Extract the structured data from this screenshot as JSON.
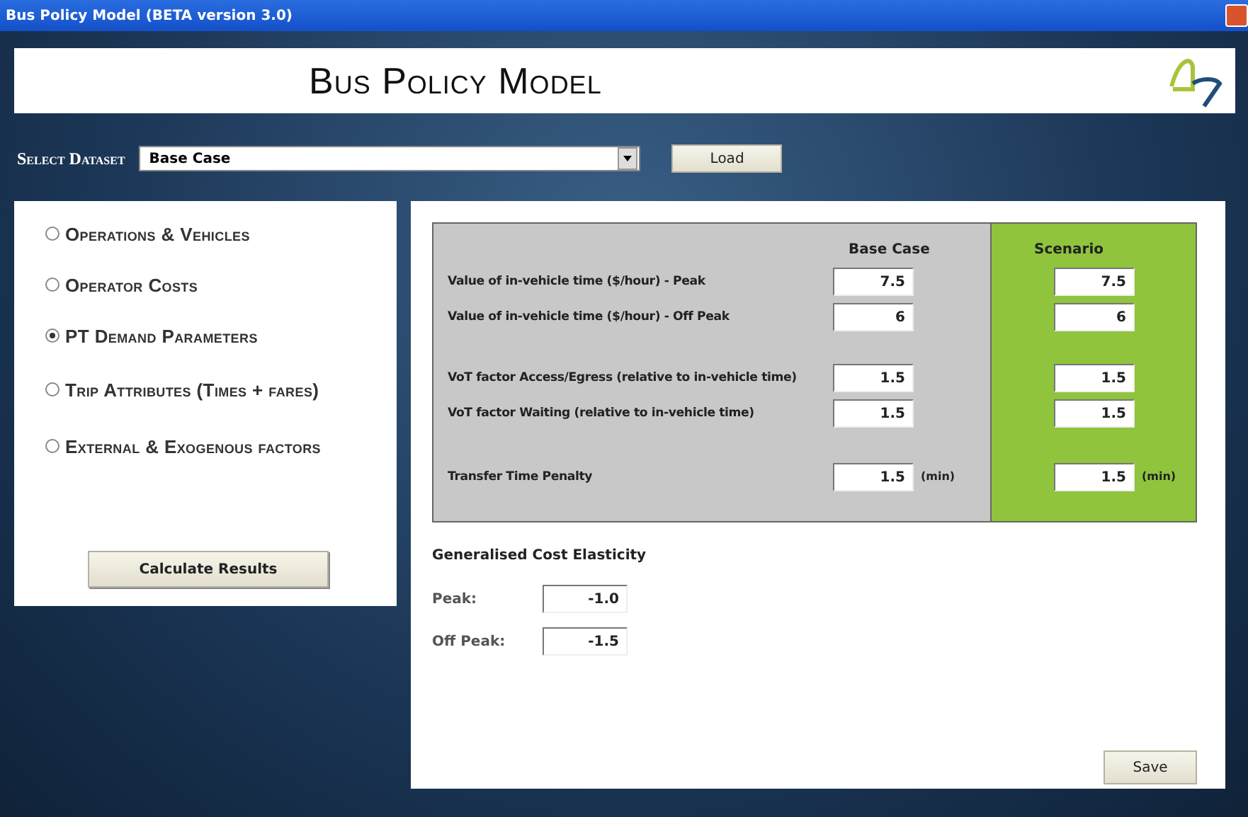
{
  "window": {
    "title": "Bus Policy Model (BETA version 3.0)"
  },
  "banner": {
    "title": "Bus Policy Model"
  },
  "dataset": {
    "label": "Select Dataset",
    "value": "Base Case",
    "load_button": "Load"
  },
  "sections": [
    {
      "label": "Operations & Vehicles",
      "selected": false
    },
    {
      "label": "Operator Costs",
      "selected": false
    },
    {
      "label": "PT Demand Parameters",
      "selected": true
    },
    {
      "label": "Trip Attributes (Times + fares)",
      "selected": false
    },
    {
      "label": "External & Exogenous factors",
      "selected": false
    }
  ],
  "calculate_button": "Calculate Results",
  "parameters": {
    "base_header": "Base Case",
    "scenario_header": "Scenario",
    "groups": [
      [
        {
          "label": "Value of in-vehicle time ($/hour) -  Peak",
          "base": "7.5",
          "scenario": "7.5"
        },
        {
          "label": "Value of in-vehicle time ($/hour) - Off Peak",
          "base": "6",
          "scenario": "6"
        }
      ],
      [
        {
          "label": "VoT factor Access/Egress (relative to in-vehicle time)",
          "base": "1.5",
          "scenario": "1.5"
        },
        {
          "label": "VoT factor Waiting (relative to in-vehicle time)",
          "base": "1.5",
          "scenario": "1.5"
        }
      ],
      [
        {
          "label": "Transfer Time Penalty",
          "base": "1.5",
          "scenario": "1.5",
          "base_unit": "(min)",
          "scenario_unit": "(min)"
        }
      ]
    ]
  },
  "elasticity": {
    "title": "Generalised Cost Elasticity",
    "rows": [
      {
        "label": "Peak:",
        "value": "-1.0"
      },
      {
        "label": "Off Peak:",
        "value": "-1.5"
      }
    ]
  },
  "save_button": "Save"
}
